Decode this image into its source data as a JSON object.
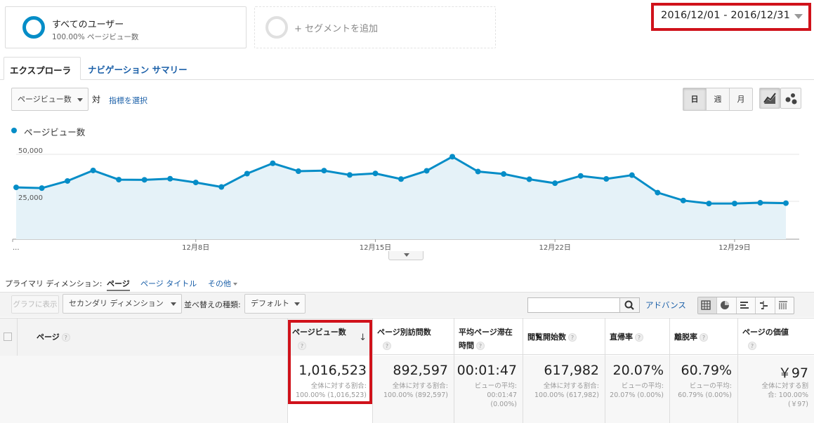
{
  "segments": {
    "primary": {
      "title": "すべてのユーザー",
      "subtitle": "100.00% ページビュー数"
    },
    "add_label": "+ セグメントを追加"
  },
  "date_range": "2016/12/01 - 2016/12/31",
  "tabs": [
    {
      "label": "エクスプローラ",
      "active": true
    },
    {
      "label": "ナビゲーション サマリー",
      "active": false
    }
  ],
  "metric_selector": {
    "value": "ページビュー数",
    "vs_label": "対",
    "choose_label": "指標を選択"
  },
  "granularity": [
    {
      "label": "日",
      "active": true
    },
    {
      "label": "週",
      "active": false
    },
    {
      "label": "月",
      "active": false
    }
  ],
  "colors": {
    "accent": "#058dc7",
    "link": "#1a5fa8",
    "highlight": "#d0121b",
    "area_fill": "#e5f2f8"
  },
  "chart_data": {
    "type": "line",
    "series": [
      {
        "name": "ページビュー数",
        "values": [
          30200,
          29800,
          33600,
          39200,
          34300,
          34200,
          34800,
          32800,
          30400,
          37500,
          43000,
          38800,
          39100,
          36800,
          37600,
          34600,
          39000,
          46500,
          38600,
          37300,
          34500,
          32400,
          36300,
          34700,
          36700,
          27400,
          23200,
          21600,
          21600,
          22000,
          21800
        ]
      }
    ],
    "x": [
      "12月1日",
      "12月2日",
      "12月3日",
      "12月4日",
      "12月5日",
      "12月6日",
      "12月7日",
      "12月8日",
      "12月9日",
      "12月10日",
      "12月11日",
      "12月12日",
      "12月13日",
      "12月14日",
      "12月15日",
      "12月16日",
      "12月17日",
      "12月18日",
      "12月19日",
      "12月20日",
      "12月21日",
      "12月22日",
      "12月23日",
      "12月24日",
      "12月25日",
      "12月26日",
      "12月27日",
      "12月28日",
      "12月29日",
      "12月30日",
      "12月31日"
    ],
    "y_ticks": [
      "50,000",
      "25,000"
    ],
    "x_ticks": [
      {
        "label": "...",
        "index": 0
      },
      {
        "label": "12月8日",
        "index": 7
      },
      {
        "label": "12月15日",
        "index": 14
      },
      {
        "label": "12月22日",
        "index": 21
      },
      {
        "label": "12月29日",
        "index": 28
      }
    ],
    "ylim": [
      0,
      50000
    ],
    "grid": true,
    "legend": "top-left"
  },
  "primary_dimension": {
    "label": "プライマリ ディメンション:",
    "active": "ページ",
    "options": [
      "ページ タイトル",
      "その他"
    ]
  },
  "toolbar": {
    "graph_button": "グラフに表示",
    "secondary_dimension": "セカンダリ ディメンション",
    "sort_label": "並べ替えの種類:",
    "sort_value": "デフォルト",
    "advanced": "アドバンス"
  },
  "table": {
    "headers": [
      {
        "label": "ページ"
      },
      {
        "label": "ページビュー数"
      },
      {
        "label": "ページ別訪問数"
      },
      {
        "label": "平均ページ滞在時間"
      },
      {
        "label": "閲覧開始数"
      },
      {
        "label": "直帰率"
      },
      {
        "label": "離脱率"
      },
      {
        "label": "ページの価値"
      }
    ],
    "totals": [
      {
        "value": "1,016,523",
        "sub1": "全体に対する割合:",
        "sub2": "100.00% (1,016,523)"
      },
      {
        "value": "892,597",
        "sub1": "全体に対する割合:",
        "sub2": "100.00% (892,597)"
      },
      {
        "value": "00:01:47",
        "sub1": "ビューの平均:",
        "sub2": "00:01:47",
        "sub3": "(0.00%)"
      },
      {
        "value": "617,982",
        "sub1": "全体に対する割合:",
        "sub2": "100.00% (617,982)"
      },
      {
        "value": "20.07%",
        "sub1": "ビューの平均:",
        "sub2": "20.07% (0.00%)"
      },
      {
        "value": "60.79%",
        "sub1": "ビューの平均:",
        "sub2": "60.79% (0.00%)"
      },
      {
        "value": "￥97",
        "sub1": "全体に対する割",
        "sub2": "合: 100.00%",
        "sub3": "(￥97)"
      }
    ]
  }
}
